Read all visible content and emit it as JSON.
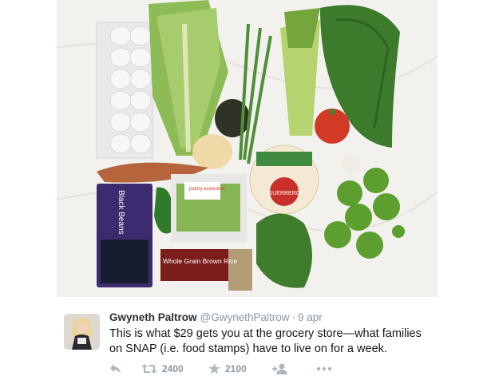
{
  "tweet": {
    "author_name": "Gwyneth Paltrow",
    "author_handle": "@GwynethPaltrow",
    "separator": "·",
    "timestamp": "9 apr",
    "text": "This is what $29 gets you at the grocery store—what families on SNAP (i.e. food stamps) have to live on for a week."
  },
  "actions": {
    "reply_icon": "reply-icon",
    "retweet_icon": "retweet-icon",
    "retweet_count": "2400",
    "favorite_icon": "star-icon",
    "favorite_count": "2100",
    "follow_icon": "add-user-icon",
    "more_icon": "more-icon"
  },
  "photo": {
    "label_beans": "Black Beans",
    "label_rice": "Whole Grain Brown Rice",
    "label_peas": "pantry essentials",
    "label_tortilla": "GUERRERO"
  },
  "colors": {
    "text": "#14171a",
    "meta": "#8899a6",
    "icon": "#aab8c2"
  }
}
